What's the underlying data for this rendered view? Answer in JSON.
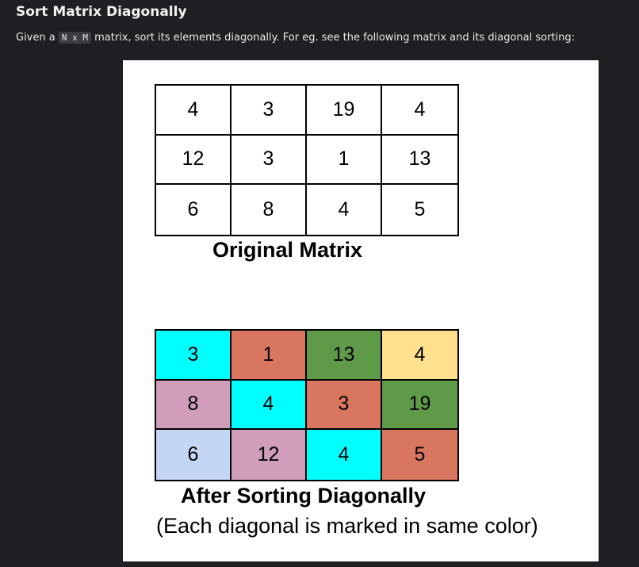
{
  "heading": {
    "title": "Sort Matrix Diagonally",
    "desc_prefix": "Given a ",
    "code": "N x M",
    "desc_suffix": " matrix, sort its elements diagonally. For eg. see the following matrix and its diagonal sorting:"
  },
  "figure": {
    "original": {
      "caption": "Original Matrix",
      "rows": [
        [
          "4",
          "3",
          "19",
          "4"
        ],
        [
          "12",
          "3",
          "1",
          "13"
        ],
        [
          "6",
          "8",
          "4",
          "5"
        ]
      ]
    },
    "sorted": {
      "caption": "After Sorting Diagonally",
      "note": "(Each diagonal is marked in same color)",
      "rows": [
        [
          "3",
          "1",
          "13",
          "4"
        ],
        [
          "8",
          "4",
          "3",
          "19"
        ],
        [
          "6",
          "12",
          "4",
          "5"
        ]
      ],
      "colors": [
        [
          "#00ffff",
          "#d97660",
          "#5e9a48",
          "#ffe08c"
        ],
        [
          "#d09dba",
          "#00ffff",
          "#d97660",
          "#5e9a48"
        ],
        [
          "#c3d6f4",
          "#d09dba",
          "#00ffff",
          "#d97660"
        ]
      ]
    }
  }
}
